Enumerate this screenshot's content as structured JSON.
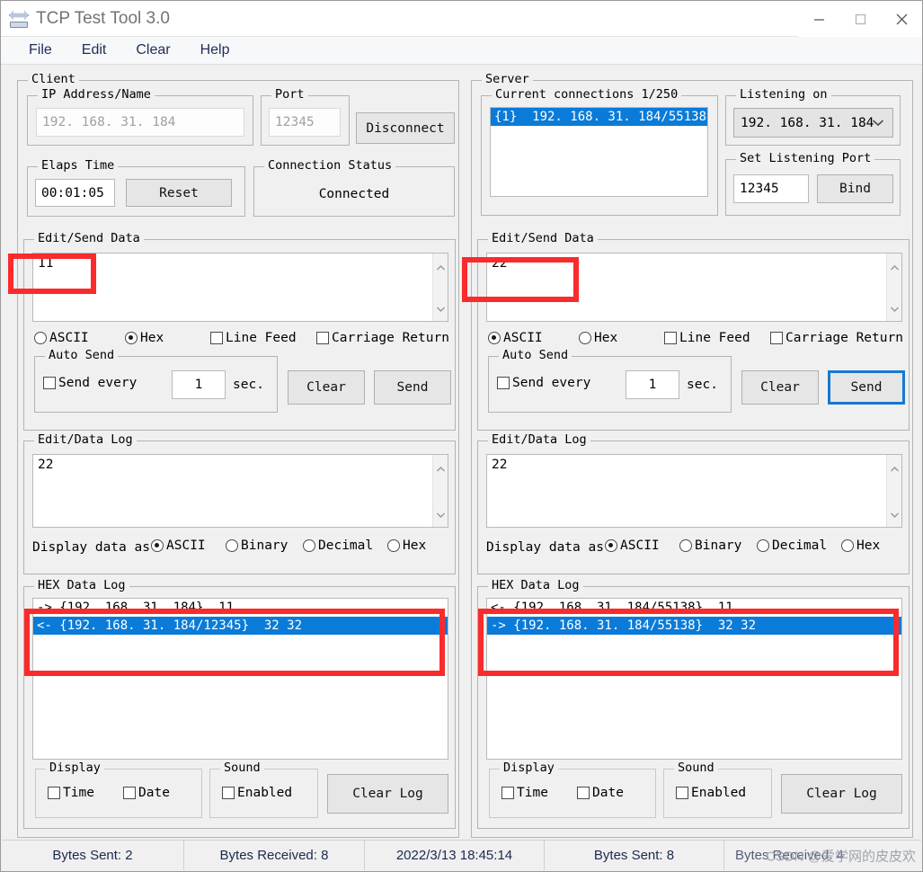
{
  "window": {
    "title": "TCP Test Tool 3.0",
    "icon": "network-arrows-icon",
    "minimize": "—",
    "maximize": "□",
    "close": "✕"
  },
  "menu": {
    "items": [
      {
        "label": "File"
      },
      {
        "label": "Edit"
      },
      {
        "label": "Clear"
      },
      {
        "label": "Help"
      }
    ]
  },
  "client": {
    "title": "Client",
    "ip_group": {
      "title": "IP Address/Name",
      "value": "192. 168. 31. 184"
    },
    "port_group": {
      "title": "Port",
      "value": "12345"
    },
    "disconnect_button": "Disconnect",
    "elaps_group": {
      "title": "Elaps Time",
      "value": "00:01:05",
      "reset_button": "Reset"
    },
    "status_group": {
      "title": "Connection Status",
      "value": "Connected"
    },
    "send_data": {
      "title": "Edit/Send Data",
      "text": "11",
      "format_options": [
        {
          "label": "ASCII",
          "selected": false
        },
        {
          "label": "Hex",
          "selected": true
        }
      ],
      "line_feed": {
        "label": "Line Feed",
        "checked": false
      },
      "carriage_return": {
        "label": "Carriage Return",
        "checked": false
      },
      "auto_send": {
        "title": "Auto Send",
        "send_every_label": "Send every",
        "send_every_checked": false,
        "interval": "1",
        "sec_label": "sec."
      },
      "clear_button": "Clear",
      "send_button": "Send",
      "send_focused": false
    },
    "data_log": {
      "title": "Edit/Data Log",
      "text": "22",
      "display_label": "Display data as",
      "display_options": [
        {
          "label": "ASCII",
          "selected": true
        },
        {
          "label": "Binary",
          "selected": false
        },
        {
          "label": "Decimal",
          "selected": false
        },
        {
          "label": "Hex",
          "selected": false
        }
      ]
    },
    "hex_log": {
      "title": "HEX Data Log",
      "rows": [
        {
          "text": "-> {192. 168. 31. 184}  11",
          "selected": false
        },
        {
          "text": "<- {192. 168. 31. 184/12345}  32 32",
          "selected": true
        }
      ],
      "display_group": {
        "title": "Display",
        "time": {
          "label": "Time",
          "checked": false
        },
        "date": {
          "label": "Date",
          "checked": false
        }
      },
      "sound_group": {
        "title": "Sound",
        "enabled": {
          "label": "Enabled",
          "checked": false
        }
      },
      "clear_log_button": "Clear Log"
    }
  },
  "server": {
    "title": "Server",
    "connections_group": {
      "title": "Current connections 1/250",
      "rows": [
        {
          "text": "{1}  192. 168. 31. 184/55138",
          "selected": true
        }
      ]
    },
    "listening_on": {
      "title": "Listening on",
      "value": "192. 168. 31. 184"
    },
    "listening_port": {
      "title": "Set Listening Port",
      "value": "12345",
      "bind_button": "Bind"
    },
    "send_data": {
      "title": "Edit/Send Data",
      "text": "22",
      "format_options": [
        {
          "label": "ASCII",
          "selected": true
        },
        {
          "label": "Hex",
          "selected": false
        }
      ],
      "line_feed": {
        "label": "Line Feed",
        "checked": false
      },
      "carriage_return": {
        "label": "Carriage Return",
        "checked": false
      },
      "auto_send": {
        "title": "Auto Send",
        "send_every_label": "Send every",
        "send_every_checked": false,
        "interval": "1",
        "sec_label": "sec."
      },
      "clear_button": "Clear",
      "send_button": "Send",
      "send_focused": true
    },
    "data_log": {
      "title": "Edit/Data Log",
      "text": "22",
      "display_label": "Display data as",
      "display_options": [
        {
          "label": "ASCII",
          "selected": true
        },
        {
          "label": "Binary",
          "selected": false
        },
        {
          "label": "Decimal",
          "selected": false
        },
        {
          "label": "Hex",
          "selected": false
        }
      ]
    },
    "hex_log": {
      "title": "HEX Data Log",
      "rows": [
        {
          "text": "<- {192. 168. 31. 184/55138}  11",
          "selected": false
        },
        {
          "text": "-> {192. 168. 31. 184/55138}  32 32",
          "selected": true
        }
      ],
      "display_group": {
        "title": "Display",
        "time": {
          "label": "Time",
          "checked": false
        },
        "date": {
          "label": "Date",
          "checked": false
        }
      },
      "sound_group": {
        "title": "Sound",
        "enabled": {
          "label": "Enabled",
          "checked": false
        }
      },
      "clear_log_button": "Clear Log"
    }
  },
  "statusbar": {
    "cells": [
      "Bytes Sent: 2",
      "Bytes Received: 8",
      "2022/3/13 18:45:14",
      "Bytes Sent: 8",
      "Bytes Received: 4"
    ],
    "watermark": "CSDN @爱学网的皮皮欢"
  },
  "colors": {
    "selection_blue": "#0a7bd8",
    "focus_blue": "#1878d0",
    "annotation_red": "#fb2b2b",
    "face": "#f0f0f0"
  }
}
